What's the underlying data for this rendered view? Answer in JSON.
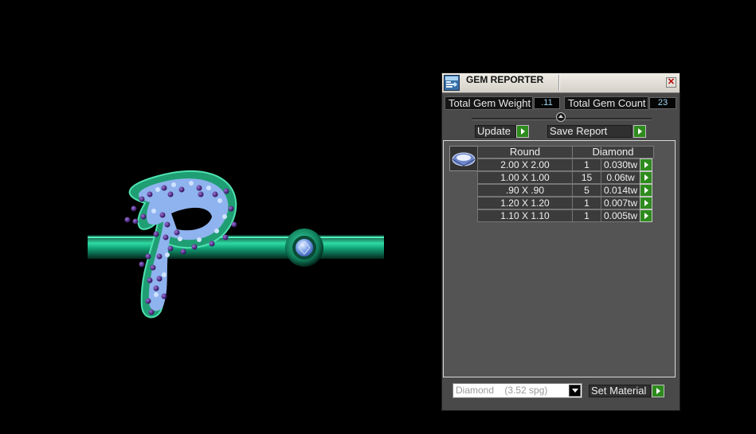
{
  "panel": {
    "title": "GEM REPORTER",
    "close_symbol": "✕",
    "total_gem_weight_label": "Total Gem Weight",
    "total_gem_weight_value": ".11",
    "total_gem_count_label": "Total Gem Count",
    "total_gem_count_value": "23",
    "update_label": "Update",
    "save_report_label": "Save Report",
    "table": {
      "shape_header": "Round",
      "material_header": "Diamond",
      "rows": [
        {
          "size": "2.00 X 2.00",
          "count": "1",
          "weight": "0.030tw"
        },
        {
          "size": "1.00 X 1.00",
          "count": "15",
          "weight": "0.06tw"
        },
        {
          "size": ".90 X .90",
          "count": "5",
          "weight": "0.014tw"
        },
        {
          "size": "1.20 X 1.20",
          "count": "1",
          "weight": "0.007tw"
        },
        {
          "size": "1.10 X 1.10",
          "count": "1",
          "weight": "0.005tw"
        }
      ]
    },
    "material_select_value": "Diamond    (3.52 spg)",
    "set_material_label": "Set Material"
  },
  "colors": {
    "panel_bg": "#494949",
    "accent_green": "#2e8b1d",
    "value_text": "#9fd3ee",
    "metal_green": "#1f9e73",
    "gem_blue": "#8fb3ee",
    "prong_purple": "#4a1c86"
  },
  "icons": [
    "gem-reporter-icon",
    "close-icon",
    "gem-shape-icon",
    "arrow-right-icon",
    "dropdown-arrow-icon"
  ]
}
